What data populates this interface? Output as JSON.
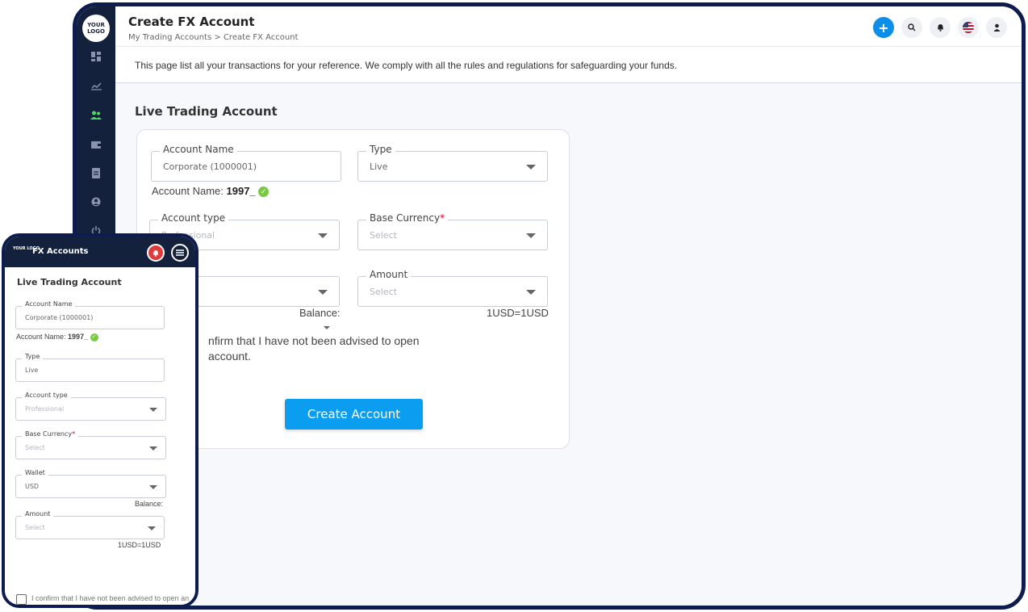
{
  "desktop": {
    "logo_text": "YOUR LOGO",
    "title": "Create FX Account",
    "breadcrumb": {
      "parent": "My Trading Accounts",
      "separator": ">",
      "current": "Create FX Account"
    },
    "info_text": "This page list all your transactions for your reference. We comply with all the rules and regulations for safeguarding your funds.",
    "section_title": "Live Trading Account",
    "form": {
      "account_name_label": "Account Name",
      "account_name_value": "Corporate (1000001)",
      "account_name_display_label": "Account Name:",
      "account_name_display_value": "1997_",
      "type_label": "Type",
      "type_value": "Live",
      "account_type_label": "Account type",
      "account_type_value": "Professional",
      "base_currency_label": "Base Currency",
      "base_currency_required": "*",
      "base_currency_value": "Select",
      "amount_label": "Amount",
      "amount_value": "Select",
      "balance_label": "Balance:",
      "rate_text": "1USD=1USD",
      "confirm_partial_line1": "nfirm that I have not been advised to open",
      "confirm_partial_line2": "account.",
      "create_button": "Create Account"
    },
    "header_icons": [
      "plus-icon",
      "search-icon",
      "bell-icon",
      "us-flag-icon",
      "user-icon"
    ],
    "sidebar_icons": [
      "dashboard-icon",
      "chart-icon",
      "users-icon",
      "wallet-icon",
      "document-icon",
      "profile-icon",
      "power-icon"
    ],
    "accent_color": "#0b9ef0",
    "sidebar_color": "#14213d"
  },
  "mobile": {
    "logo_text": "YOUR LOGO",
    "title": "FX Accounts",
    "section_title": "Live Trading Account",
    "account_name_label": "Account Name",
    "account_name_value": "Corporate (1000001)",
    "account_name_display_label": "Account Name:",
    "account_name_display_value": "1997_",
    "type_label": "Type",
    "type_value": "Live",
    "account_type_label": "Account type",
    "account_type_value": "Professional",
    "base_currency_label": "Base Currency",
    "base_currency_required": "*",
    "base_currency_value": "Select",
    "wallet_label": "Wallet",
    "wallet_value": "USD",
    "balance_label": "Balance:",
    "amount_label": "Amount",
    "amount_value": "Select",
    "rate_text": "1USD=1USD",
    "confirm_text": "I confirm that I have not been advised to open an account."
  }
}
